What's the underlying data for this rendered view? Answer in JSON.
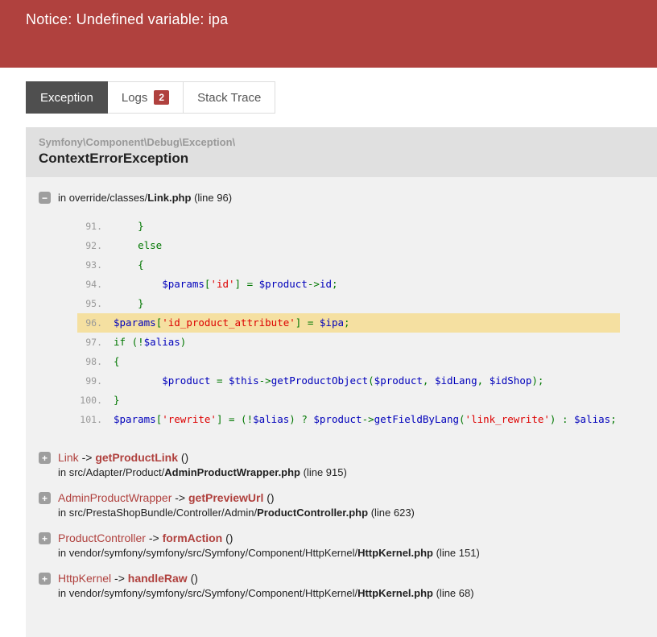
{
  "banner": {
    "message": "Notice: Undefined variable: ipa"
  },
  "tabs": [
    {
      "label": "Exception",
      "active": true
    },
    {
      "label": "Logs",
      "badge": "2",
      "active": false
    },
    {
      "label": "Stack Trace",
      "active": false
    }
  ],
  "icons": {
    "collapse_glyph": "−",
    "expand_glyph": "+"
  },
  "labels": {
    "arrow": " -> ",
    "args": " ()"
  },
  "theme": {
    "accent_red": "#B0413E",
    "active_tab_bg": "#4F4F4F",
    "panel_bg": "#F1F1F1",
    "panel_head_bg": "#E0E0E0",
    "highlight_line_bg": "#F5E0A1",
    "code_keyword": "#007700",
    "code_variable": "#0000BB",
    "code_string": "#DD0000"
  },
  "exception": {
    "namespace": "Symfony\\Component\\Debug\\Exception\\",
    "class": "ContextErrorException",
    "trace_head": {
      "prefix": "in override/classes/",
      "file": "Link.php",
      "line_suffix": " (line 96)"
    },
    "code": {
      "highlight_line": "96.",
      "lines": [
        {
          "num": "91.",
          "hl": false,
          "tokens": [
            {
              "s": "    }",
              "c": "kw"
            }
          ]
        },
        {
          "num": "92.",
          "hl": false,
          "tokens": [
            {
              "s": "    else",
              "c": "kw"
            }
          ]
        },
        {
          "num": "93.",
          "hl": false,
          "tokens": [
            {
              "s": "    {",
              "c": "kw"
            }
          ]
        },
        {
          "num": "94.",
          "hl": false,
          "tokens": [
            {
              "s": "        ",
              "c": "kw"
            },
            {
              "s": "$params",
              "c": "var"
            },
            {
              "s": "[",
              "c": "kw"
            },
            {
              "s": "'id'",
              "c": "str"
            },
            {
              "s": "] = ",
              "c": "kw"
            },
            {
              "s": "$product",
              "c": "var"
            },
            {
              "s": "->",
              "c": "kw"
            },
            {
              "s": "id",
              "c": "var"
            },
            {
              "s": ";",
              "c": "kw"
            }
          ]
        },
        {
          "num": "95.",
          "hl": false,
          "tokens": [
            {
              "s": "    }",
              "c": "kw"
            }
          ]
        },
        {
          "num": "96.",
          "hl": true,
          "tokens": [
            {
              "s": "$params",
              "c": "var"
            },
            {
              "s": "[",
              "c": "kw"
            },
            {
              "s": "'id_product_attribute'",
              "c": "str"
            },
            {
              "s": "] = ",
              "c": "kw"
            },
            {
              "s": "$ipa",
              "c": "var"
            },
            {
              "s": ";",
              "c": "kw"
            }
          ]
        },
        {
          "num": "97.",
          "hl": false,
          "tokens": [
            {
              "s": "if (!",
              "c": "kw"
            },
            {
              "s": "$alias",
              "c": "var"
            },
            {
              "s": ")",
              "c": "kw"
            }
          ]
        },
        {
          "num": "98.",
          "hl": false,
          "tokens": [
            {
              "s": "{",
              "c": "kw"
            }
          ]
        },
        {
          "num": "99.",
          "hl": false,
          "tokens": [
            {
              "s": "        ",
              "c": "kw"
            },
            {
              "s": "$product",
              "c": "var"
            },
            {
              "s": " = ",
              "c": "kw"
            },
            {
              "s": "$this",
              "c": "var"
            },
            {
              "s": "->",
              "c": "kw"
            },
            {
              "s": "getProductObject",
              "c": "var"
            },
            {
              "s": "(",
              "c": "kw"
            },
            {
              "s": "$product",
              "c": "var"
            },
            {
              "s": ", ",
              "c": "kw"
            },
            {
              "s": "$idLang",
              "c": "var"
            },
            {
              "s": ", ",
              "c": "kw"
            },
            {
              "s": "$idShop",
              "c": "var"
            },
            {
              "s": ");",
              "c": "kw"
            }
          ]
        },
        {
          "num": "100.",
          "hl": false,
          "tokens": [
            {
              "s": "}",
              "c": "kw"
            }
          ]
        },
        {
          "num": "101.",
          "hl": false,
          "tokens": [
            {
              "s": "$params",
              "c": "var"
            },
            {
              "s": "[",
              "c": "kw"
            },
            {
              "s": "'rewrite'",
              "c": "str"
            },
            {
              "s": "] = (!",
              "c": "kw"
            },
            {
              "s": "$alias",
              "c": "var"
            },
            {
              "s": ") ? ",
              "c": "kw"
            },
            {
              "s": "$product",
              "c": "var"
            },
            {
              "s": "->",
              "c": "kw"
            },
            {
              "s": "getFieldByLang",
              "c": "var"
            },
            {
              "s": "(",
              "c": "kw"
            },
            {
              "s": "'link_rewrite'",
              "c": "str"
            },
            {
              "s": ") : ",
              "c": "kw"
            },
            {
              "s": "$alias",
              "c": "var"
            },
            {
              "s": ";",
              "c": "kw"
            }
          ]
        }
      ]
    },
    "frames": [
      {
        "class": "Link",
        "method": "getProductLink",
        "loc_prefix": "in src/Adapter/Product/",
        "loc_file": "AdminProductWrapper.php",
        "loc_suffix": " (line 915)"
      },
      {
        "class": "AdminProductWrapper",
        "method": "getPreviewUrl",
        "loc_prefix": "in src/PrestaShopBundle/Controller/Admin/",
        "loc_file": "ProductController.php",
        "loc_suffix": " (line 623)"
      },
      {
        "class": "ProductController",
        "method": "formAction",
        "loc_prefix": "in vendor/symfony/symfony/src/Symfony/Component/HttpKernel/",
        "loc_file": "HttpKernel.php",
        "loc_suffix": " (line 151)"
      },
      {
        "class": "HttpKernel",
        "method": "handleRaw",
        "loc_prefix": "in vendor/symfony/symfony/src/Symfony/Component/HttpKernel/",
        "loc_file": "HttpKernel.php",
        "loc_suffix": " (line 68)"
      }
    ]
  }
}
